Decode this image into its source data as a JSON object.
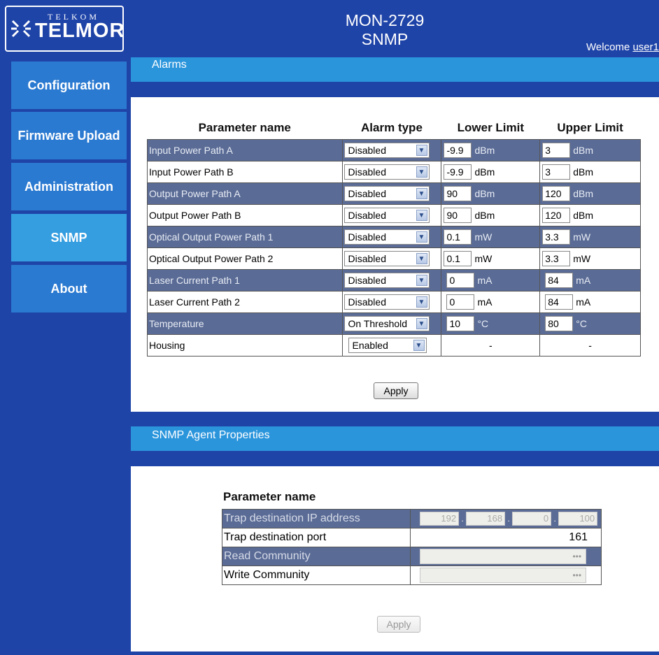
{
  "logo": {
    "top_text": "TELKOM",
    "main_text": "TELMOR"
  },
  "header": {
    "model": "MON-2729",
    "page": "SNMP",
    "welcome_text": "Welcome ",
    "user": "user1"
  },
  "nav": [
    {
      "label": "Configuration"
    },
    {
      "label": "Firmware Upload"
    },
    {
      "label": "Administration"
    },
    {
      "label": "SNMP"
    },
    {
      "label": "About"
    }
  ],
  "alarms": {
    "title": "Alarms",
    "headers": {
      "name": "Parameter name",
      "type": "Alarm type",
      "lower": "Lower Limit",
      "upper": "Upper Limit"
    },
    "rows": [
      {
        "name": "Input Power Path A",
        "type": "Disabled",
        "lower": "-9.9",
        "lower_unit": "dBm",
        "upper": "3",
        "upper_unit": "dBm"
      },
      {
        "name": "Input Power Path B",
        "type": "Disabled",
        "lower": "-9.9",
        "lower_unit": "dBm",
        "upper": "3",
        "upper_unit": "dBm"
      },
      {
        "name": "Output Power Path A",
        "type": "Disabled",
        "lower": "90",
        "lower_unit": "dBm",
        "upper": "120",
        "upper_unit": "dBm"
      },
      {
        "name": "Output Power Path B",
        "type": "Disabled",
        "lower": "90",
        "lower_unit": "dBm",
        "upper": "120",
        "upper_unit": "dBm"
      },
      {
        "name": "Optical Output Power Path 1",
        "type": "Disabled",
        "lower": "0.1",
        "lower_unit": "mW",
        "upper": "3.3",
        "upper_unit": "mW"
      },
      {
        "name": "Optical Output Power Path 2",
        "type": "Disabled",
        "lower": "0.1",
        "lower_unit": "mW",
        "upper": "3.3",
        "upper_unit": "mW"
      },
      {
        "name": "Laser Current Path 1",
        "type": "Disabled",
        "lower": "0",
        "lower_unit": "mA",
        "upper": "84",
        "upper_unit": "mA"
      },
      {
        "name": "Laser Current Path 2",
        "type": "Disabled",
        "lower": "0",
        "lower_unit": "mA",
        "upper": "84",
        "upper_unit": "mA"
      },
      {
        "name": "Temperature",
        "type": "On Threshold",
        "lower": "10",
        "lower_unit": "°C",
        "upper": "80",
        "upper_unit": "°C"
      },
      {
        "name": "Housing",
        "type": "Enabled",
        "lower": "-",
        "upper": "-"
      }
    ],
    "apply_label": "Apply"
  },
  "snmp": {
    "title": "SNMP Agent Properties",
    "header": "Parameter name",
    "trap_ip_label": "Trap destination IP address",
    "trap_ip": [
      "192",
      "168",
      "0",
      "100"
    ],
    "trap_port_label": "Trap destination port",
    "trap_port": "161",
    "read_label": "Read Community",
    "read_value": "•••",
    "write_label": "Write Community",
    "write_value": "•••",
    "apply_label": "Apply"
  },
  "colors": {
    "background": "#1f44a8",
    "section_bar": "#2b95dc",
    "nav_button": "#2b7ad1",
    "nav_active": "#359ee0",
    "row_dark": "#5a6b95"
  }
}
